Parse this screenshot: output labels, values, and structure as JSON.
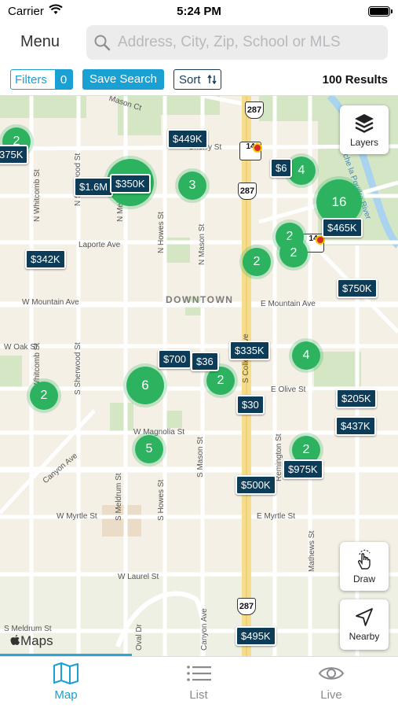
{
  "status": {
    "carrier": "Carrier",
    "time": "5:24 PM"
  },
  "topbar": {
    "menu_label": "Menu",
    "search_placeholder": "Address, City, Zip, School or MLS"
  },
  "filterbar": {
    "filters_label": "Filters",
    "filters_count": "0",
    "save_search_label": "Save Search",
    "sort_label": "Sort",
    "results": "100 Results"
  },
  "map": {
    "downtown": "DOWNTOWN",
    "streets": {
      "mason_ct": "Mason Ct",
      "cherry_st": "Cherry St",
      "laporte_ave": "Laporte Ave",
      "w_mountain_ave": "W Mountain Ave",
      "e_mountain_ave": "E Mountain Ave",
      "w_oak_st": "W Oak St",
      "e_olive_st": "E Olive St",
      "w_magnolia_st": "W Magnolia St",
      "canyon_ave": "Canyon Ave",
      "w_myrtle_st": "W Myrtle St",
      "e_myrtle_st": "E Myrtle St",
      "w_laurel_st": "W Laurel St",
      "s_meldrum_st_bottom": "S Meldrum St",
      "n_whitcomb_st": "N Whitcomb St",
      "n_sherwood_st": "N Sherwood St",
      "n_meldrum_st": "N Meldrum St",
      "n_howes_st": "N Howes St",
      "n_mason_st": "N Mason St",
      "s_whitcomb_st": "S Whitcomb St",
      "s_sherwood_st": "S Sherwood St",
      "s_meldrum_st": "S Meldrum St",
      "s_howes_st": "S Howes St",
      "s_mason_st": "S Mason St",
      "s_college_ave": "S College Ave",
      "remington_st": "Remington St",
      "mathews_st": "Mathews St",
      "oval_dr": "Oval Dr",
      "canyon_ave_bottom": "Canyon Ave",
      "poudre_river": "Cache la Poudre River",
      "s_whitcomb_edge": "S Whitcomb St"
    },
    "routes": {
      "r287_a": "287",
      "r287_b": "287",
      "r287_c": "287",
      "r14_a": "14",
      "r14_b": "14"
    },
    "clusters": [
      {
        "n": "2"
      },
      {
        "n": "4"
      },
      {
        "n": "3"
      },
      {
        "n": "16"
      },
      {
        "n": "2"
      },
      {
        "n": "2"
      },
      {
        "n": "2"
      },
      {
        "n": "4"
      },
      {
        "n": "2"
      },
      {
        "n": "6"
      },
      {
        "n": "2"
      },
      {
        "n": "5"
      },
      {
        "n": "2"
      }
    ],
    "prices": [
      {
        "label": "$449K"
      },
      {
        "label": "375K"
      },
      {
        "label": "$1.6M"
      },
      {
        "label": "$350K"
      },
      {
        "label": "$6"
      },
      {
        "label": "$465K"
      },
      {
        "label": "$342K"
      },
      {
        "label": "$750K"
      },
      {
        "label": "$335K"
      },
      {
        "label": "$700"
      },
      {
        "label": "$36"
      },
      {
        "label": "$205K"
      },
      {
        "label": "$30"
      },
      {
        "label": "$437K"
      },
      {
        "label": "$975K"
      },
      {
        "label": "$500K"
      },
      {
        "label": "$495K"
      }
    ],
    "buttons": {
      "layers_label": "Layers",
      "draw_label": "Draw",
      "nearby_label": "Nearby"
    },
    "attribution": "Maps"
  },
  "tabs": {
    "map": "Map",
    "list": "List",
    "live": "Live"
  },
  "colors": {
    "accent": "#1aa0d3",
    "cluster": "#2db35f",
    "price_pin": "#0d3c58"
  }
}
